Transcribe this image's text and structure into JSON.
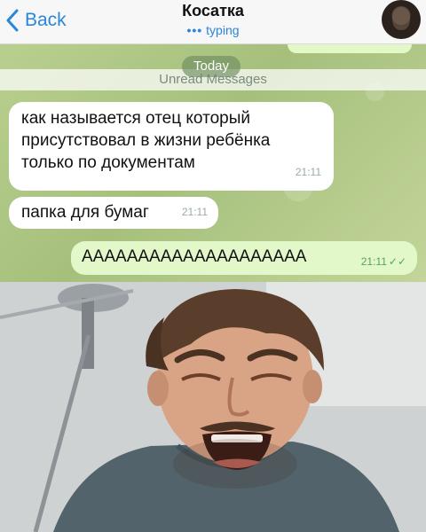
{
  "header": {
    "back_label": "Back",
    "contact_name": "Косатка",
    "status_text": "typing"
  },
  "chat": {
    "date_badge": "Today",
    "unread_label": "Unread Messages",
    "messages": [
      {
        "direction": "incoming",
        "lines": [
          "как называется отец который",
          "присутствовал в жизни ребёнка",
          "только по документам"
        ],
        "time": "21:11"
      },
      {
        "direction": "incoming",
        "lines": [
          "папка для бумаг"
        ],
        "time": "21:11"
      },
      {
        "direction": "outgoing",
        "lines": [
          "АААААААААААААААААААА"
        ],
        "time": "21:11",
        "read_checks": "✓✓"
      }
    ]
  },
  "colors": {
    "accent_blue": "#2a86d8",
    "outgoing_bubble": "#e2f8c8",
    "chat_background": "#b9cf8e"
  }
}
